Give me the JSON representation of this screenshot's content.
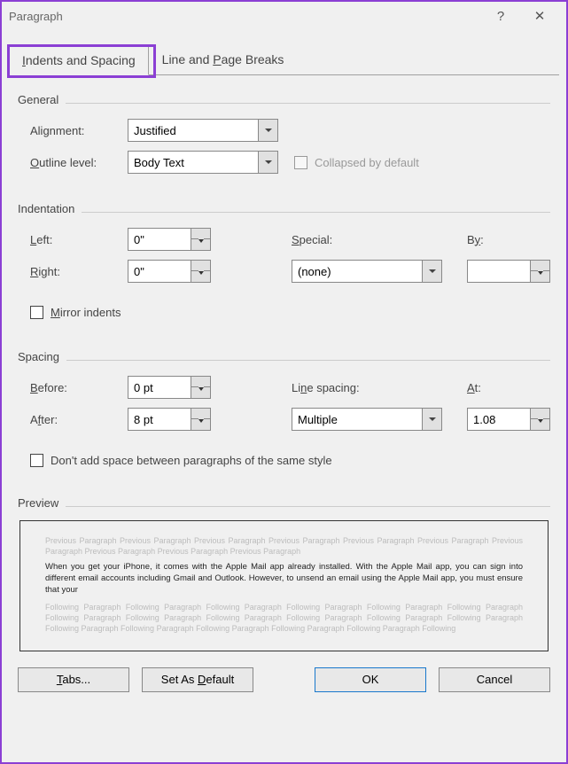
{
  "window": {
    "title": "Paragraph"
  },
  "tabs": {
    "indents": {
      "prefix": "I",
      "rest": "ndents and Spacing"
    },
    "line": {
      "prefix_plain": "Line and ",
      "u": "P",
      "rest": "age Breaks"
    }
  },
  "general": {
    "title": "General",
    "alignment_label": "Alignment:",
    "alignment_value": "Justified",
    "outline_u": "O",
    "outline_rest": "utline level:",
    "outline_value": "Body Text",
    "collapsed_label": "Collapsed by default"
  },
  "indentation": {
    "title": "Indentation",
    "left_u": "L",
    "left_rest": "eft:",
    "left_value": "0\"",
    "right_u": "R",
    "right_rest": "ight:",
    "right_value": "0\"",
    "special_u": "S",
    "special_rest": "pecial:",
    "special_value": "(none)",
    "by_u": "y",
    "by_pre": "B",
    "by_rest": ":",
    "by_value": "",
    "mirror_u": "M",
    "mirror_rest": "irror indents"
  },
  "spacing": {
    "title": "Spacing",
    "before_u": "B",
    "before_rest": "efore:",
    "before_value": "0 pt",
    "after_u": "f",
    "after_pre": "A",
    "after_rest": "ter:",
    "after_value": "8 pt",
    "linespacing_u": "n",
    "linespacing_pre": "Li",
    "linespacing_rest": "e spacing:",
    "linespacing_value": "Multiple",
    "at_u": "A",
    "at_rest": "t:",
    "at_value": "1.08",
    "dontadd_label": "Don't add space between paragraphs of the same style"
  },
  "preview": {
    "title": "Preview",
    "ghost_prev": "Previous Paragraph Previous Paragraph Previous Paragraph Previous Paragraph Previous Paragraph Previous Paragraph Previous Paragraph Previous Paragraph Previous Paragraph Previous Paragraph",
    "sample": "When you get your iPhone, it comes with the Apple Mail app already installed. With the Apple Mail app, you can sign into different email accounts including Gmail and Outlook. However, to unsend an email using the Apple Mail app, you must ensure that your",
    "ghost_next": "Following Paragraph Following Paragraph Following Paragraph Following Paragraph Following Paragraph Following Paragraph Following Paragraph Following Paragraph Following Paragraph Following Paragraph Following Paragraph Following Paragraph Following Paragraph Following Paragraph Following Paragraph Following Paragraph Following Paragraph Following"
  },
  "buttons": {
    "tabs_u": "T",
    "tabs_rest": "abs...",
    "default_u": "D",
    "default_pre": "Set As ",
    "default_rest": "efault",
    "ok": "OK",
    "cancel": "Cancel"
  }
}
